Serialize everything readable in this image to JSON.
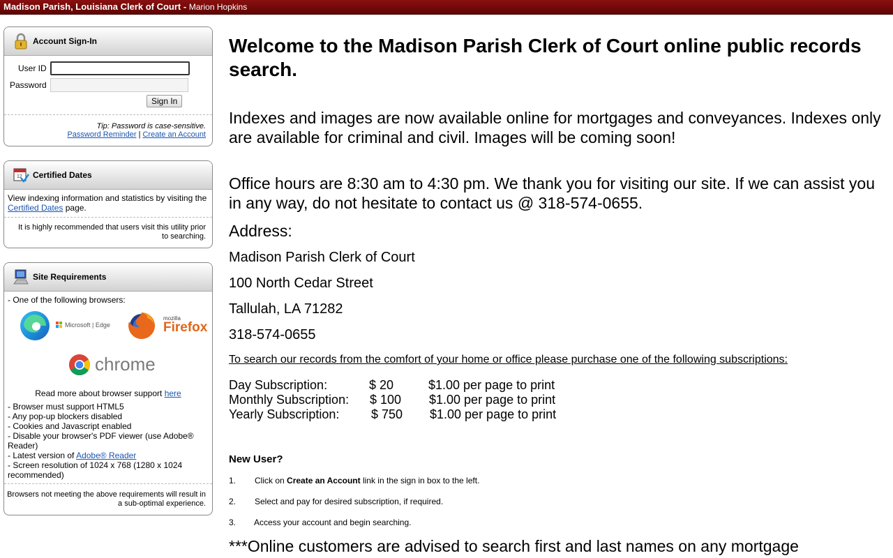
{
  "header": {
    "title": "Madison Parish, Louisiana Clerk of Court -",
    "subtitle": "Marion Hopkins"
  },
  "signin": {
    "title": "Account Sign-In",
    "userid_label": "User ID",
    "password_label": "Password",
    "userid_value": "",
    "password_value": "",
    "button": "Sign In",
    "tip": "Tip: Password is case-sensitive.",
    "reminder_link": "Password Reminder",
    "separator": "|",
    "create_link": "Create an Account"
  },
  "certified": {
    "title": "Certified Dates",
    "text1": "View indexing information and statistics by visiting the",
    "link": "Certified Dates",
    "text2": "page.",
    "note": "It is highly recommended that users visit this utility prior to searching."
  },
  "requirements": {
    "title": "Site Requirements",
    "intro": "- One of the following browsers:",
    "edge_text": "Microsoft | Edge",
    "firefox_small": "mozilla",
    "firefox_text": "Firefox",
    "chrome_text": "chrome",
    "readmore": "Read more about browser support",
    "readmore_link": "here",
    "items": [
      "- Browser must support HTML5",
      "- Any pop-up blockers disabled",
      "- Cookies and Javascript enabled",
      "- Disable your browser's PDF viewer (use Adobe® Reader)"
    ],
    "latest_prefix": "- Latest version of",
    "latest_link": "Adobe® Reader",
    "resolution": "- Screen resolution of 1024 x 768 (1280 x 1024 recommended)",
    "note": "Browsers not meeting the above requirements will result in a sub-optimal experience."
  },
  "main": {
    "welcome": "Welcome to the Madison Parish Clerk of Court online public records search.",
    "indexes": "Indexes and images are now available online for mortgages and conveyances. Indexes only are available for criminal and civil. Images will be coming soon!",
    "hours": "Office hours are 8:30 am to 4:30 pm. We thank you for visiting our site. If we can assist you in any way, do not hesitate to contact us @ 318-574-0655.",
    "address_label": "Address:",
    "address": [
      "Madison Parish Clerk of Court",
      "100 North Cedar Street",
      "Tallulah, LA 71282",
      "318-574-0655"
    ],
    "subs_intro": "To search our records from the comfort of your home or office please purchase one of the following subscriptions:",
    "subscriptions": [
      {
        "name": "Day Subscription:",
        "price": "$ 20",
        "print": "$1.00 per page to print"
      },
      {
        "name": "Monthly Subscription:",
        "price": "$ 100",
        "print": "$1.00 per page to print"
      },
      {
        "name": "Yearly Subscription:",
        "price": "$ 750",
        "print": "$1.00 per page to print"
      }
    ],
    "new_user": "New User?",
    "steps": [
      {
        "num": "1.",
        "pre": "Click on",
        "bold": "Create an Account",
        "post": "link in the sign in box to the left."
      },
      {
        "num": "2.",
        "pre": "Select and pay for desired subscription, if required.",
        "bold": "",
        "post": ""
      },
      {
        "num": "3.",
        "pre": "Access your account and begin searching.",
        "bold": "",
        "post": ""
      }
    ],
    "advisory": "***Online customers are advised to search first and last names on any mortgage"
  }
}
